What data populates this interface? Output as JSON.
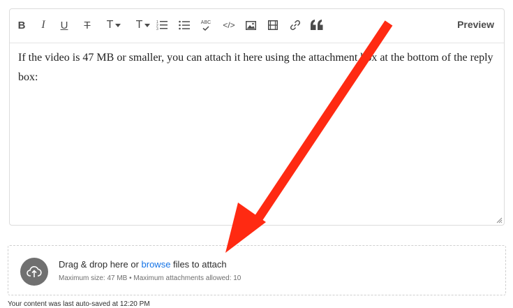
{
  "toolbar": {
    "buttons": [
      {
        "name": "bold",
        "icon": "bold-icon",
        "label": "B"
      },
      {
        "name": "italic",
        "icon": "italic-icon",
        "label": "I"
      },
      {
        "name": "underline",
        "icon": "underline-icon",
        "label": "U"
      },
      {
        "name": "strikethrough",
        "icon": "strikethrough-icon",
        "label": "T"
      },
      {
        "name": "font-size",
        "icon": "font-size-icon",
        "label": "T"
      },
      {
        "name": "text-color",
        "icon": "text-color-icon",
        "label": "T"
      },
      {
        "name": "numbered-list",
        "icon": "numbered-list-icon"
      },
      {
        "name": "bulleted-list",
        "icon": "bulleted-list-icon"
      },
      {
        "name": "spellcheck",
        "icon": "spellcheck-icon",
        "label": "ABC"
      },
      {
        "name": "code",
        "icon": "code-icon",
        "label": "</>"
      },
      {
        "name": "insert-image",
        "icon": "image-icon"
      },
      {
        "name": "insert-video",
        "icon": "video-icon"
      },
      {
        "name": "insert-link",
        "icon": "link-icon"
      },
      {
        "name": "quote",
        "icon": "quote-icon"
      }
    ],
    "preview_label": "Preview"
  },
  "editor": {
    "content": "If the video is 47 MB or smaller, you can attach it here using the attachment box at the bottom of the reply box:"
  },
  "dropzone": {
    "icon": "upload-icon",
    "text_before": "Drag & drop here or ",
    "browse_label": "browse",
    "text_after": " files to attach",
    "limits": "Maximum size: 47 MB • Maximum attachments allowed: 10"
  },
  "footer": {
    "autosave_text": "Your content was last auto-saved at 12:20 PM"
  },
  "colors": {
    "annotation_arrow": "#ff2a12",
    "link": "#1473e6"
  }
}
